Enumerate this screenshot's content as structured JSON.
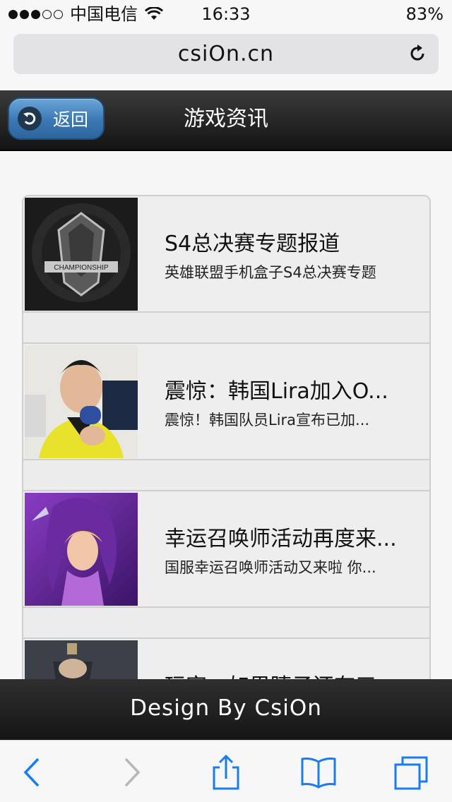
{
  "status_bar": {
    "carrier": "中国电信",
    "time": "16:33",
    "battery": "83%",
    "signal_bars_filled": 3,
    "signal_bars_total": 5
  },
  "browser": {
    "url": "csiOn.cn"
  },
  "header": {
    "back_label": "返回",
    "title": "游戏资讯"
  },
  "news": [
    {
      "title": "S4总决赛专题报道",
      "desc": "英雄联盟手机盒子S4总决赛专题",
      "thumb": "championship-logo"
    },
    {
      "title": "震惊：韩国Lira加入O...",
      "desc": "震惊！韩国队员Lira宣布已加...",
      "thumb": "player-photo"
    },
    {
      "title": "幸运召唤师活动再度来...",
      "desc": "国服幸运召唤师活动又来啦 你...",
      "thumb": "champion-art"
    },
    {
      "title": "玩家：如果睫子还有三",
      "desc": "",
      "thumb": "warrior-art"
    }
  ],
  "footer": {
    "text": "Design By CsiOn"
  },
  "colors": {
    "back_button": "#3a78b4",
    "header_bg": "#1e1e1e",
    "ios_blue": "#1a7cf5"
  }
}
